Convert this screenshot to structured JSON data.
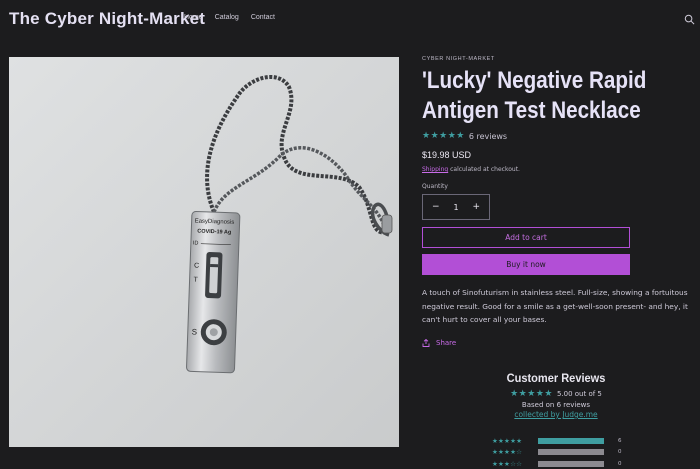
{
  "header": {
    "logo": "The Cyber Night-Market",
    "nav": [
      "Home",
      "Catalog",
      "Contact"
    ]
  },
  "product": {
    "vendor": "CYBER NIGHT-MARKET",
    "title_line1": "'Lucky' Negative Rapid",
    "title_line2": "Antigen Test Necklace",
    "stars": "★★★★★",
    "reviews_count": "6 reviews",
    "price": "$19.98 USD",
    "shipping_link": "Shipping",
    "shipping_text": " calculated at checkout.",
    "quantity_label": "Quantity",
    "quantity_value": "1",
    "minus": "−",
    "plus": "+",
    "add_to_cart": "Add to cart",
    "buy_now": "Buy it now",
    "description": "A touch of Sinofuturism in stainless steel. Full-size, showing a fortuitous negative result. Good for a smile as a get-well-soon present- and hey, it can't hurt to cover all your bases.",
    "share": "Share",
    "image_texts": {
      "brand": "EasyDiagnosis",
      "test": "COVID-19 Ag",
      "id": "ID",
      "c": "C",
      "t": "T",
      "s": "S"
    }
  },
  "reviews": {
    "title": "Customer Reviews",
    "stars": "★★★★★",
    "score": "5.00 out of 5",
    "based_on": "Based on 6 reviews",
    "collected_by": "collected by Judge.me",
    "histogram": [
      {
        "stars": "★★★★★",
        "fraction": 1.0,
        "count": "6"
      },
      {
        "stars": "★★★★☆",
        "fraction": 0.0,
        "count": "0"
      },
      {
        "stars": "★★★☆☆",
        "fraction": 0.0,
        "count": "0"
      }
    ]
  },
  "colors": {
    "background": "#1c1c1e",
    "accent": "#b24fd6",
    "star": "#3f9ea1"
  }
}
